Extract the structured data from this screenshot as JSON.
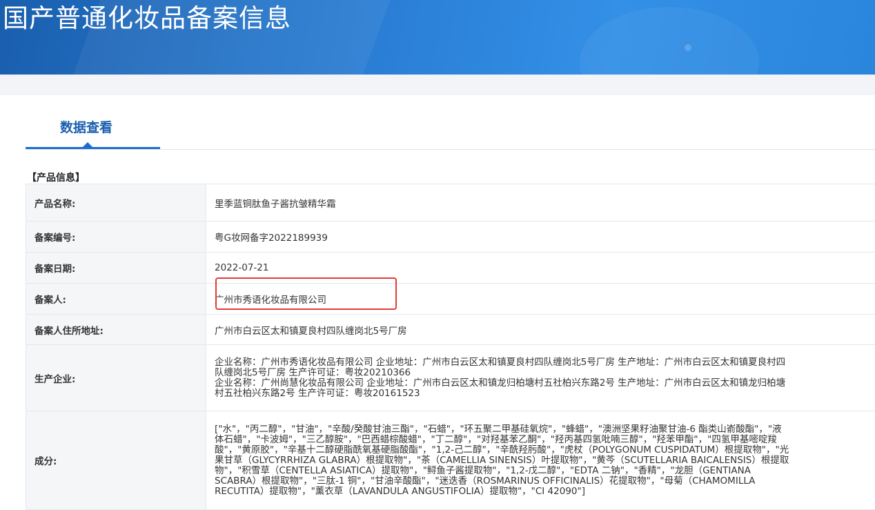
{
  "banner": {
    "title": "国产普通化妆品备案信息"
  },
  "tabs": [
    {
      "label": "数据查看"
    }
  ],
  "section": {
    "label": "【产品信息】"
  },
  "rows": {
    "product_name": {
      "label": "产品名称:",
      "value": "里季蓝铜肽鱼子酱抗皱精华霜"
    },
    "filing_number": {
      "label": "备案编号:",
      "value": "粤G妆网备字2022189939"
    },
    "filing_date": {
      "label": "备案日期:",
      "value": "2022-07-21"
    },
    "filer": {
      "label": "备案人:",
      "value": "广州市秀语化妆品有限公司"
    },
    "filer_address": {
      "label": "备案人住所地址:",
      "value": "广州市白云区太和镇夏良村四队缠岗北5号厂房"
    },
    "manufacturer": {
      "label": "生产企业:",
      "lines": [
        "企业名称：广州市秀语化妆品有限公司 企业地址：广州市白云区太和镇夏良村四队缠岗北5号厂房 生产地址：广州市白云区太和镇夏良村四",
        "队缠岗北5号厂房 生产许可证：粤妆20210366",
        "企业名称：广州尚慧化妆品有限公司 企业地址：广州市白云区太和镇龙归柏塘村五社柏兴东路2号 生产地址：广州市白云区太和镇龙归柏塘",
        "村五社柏兴东路2号 生产许可证：粤妆20161523"
      ]
    },
    "ingredients": {
      "label": "成分:",
      "lines": [
        "[\"水\"，\"丙二醇\"，\"甘油\"，\"辛酸/癸酸甘油三酯\"，\"石蜡\"，\"环五聚二甲基硅氧烷\"，\"蜂蜡\"，\"澳洲坚果籽油聚甘油-6 酯类山嵛酸酯\"，\"液",
        "体石蜡\"，\"卡波姆\"，\"三乙醇胺\"，\"巴西蜡棕酸蜡\"，\"丁二醇\"，\"对羟基苯乙酮\"，\"羟丙基四氢吡喃三醇\"，\"羟苯甲酯\"，\"四氢甲基嘧啶羧",
        "酸\"，\"黄原胶\"，\"辛基十二醇硬脂酰氧基硬脂酸酯\"，\"1,2-己二醇\"，\"辛酰羟肟酸\"，\"虎杖（POLYGONUM CUSPIDATUM）根提取物\"，\"光",
        "果甘草（GLYCYRRHIZA GLABRA）根提取物\"，\"茶（CAMELLIA SINENSIS）叶提取物\"，\"黄芩（SCUTELLARIA BAICALENSIS）根提取",
        "物\"，\"积雪草（CENTELLA ASIATICA）提取物\"，\"鲟鱼子酱提取物\"，\"1,2-戊二醇\"，\"EDTA 二钠\"，\"香精\"，\"龙胆（GENTIANA",
        "SCABRA）根提取物\"，\"三肽-1 铜\"，\"甘油辛酸酯\"，\"迷迭香（ROSMARINUS OFFICINALIS）花提取物\"，\"母菊（CHAMOMILLA",
        "RECUTITA）提取物\"，\"薰衣草（LAVANDULA ANGUSTIFOLIA）提取物\"，\"CI 42090\"]"
      ]
    }
  },
  "colors": {
    "brand_blue": "#1a5fae",
    "highlight_red": "#e53935"
  }
}
